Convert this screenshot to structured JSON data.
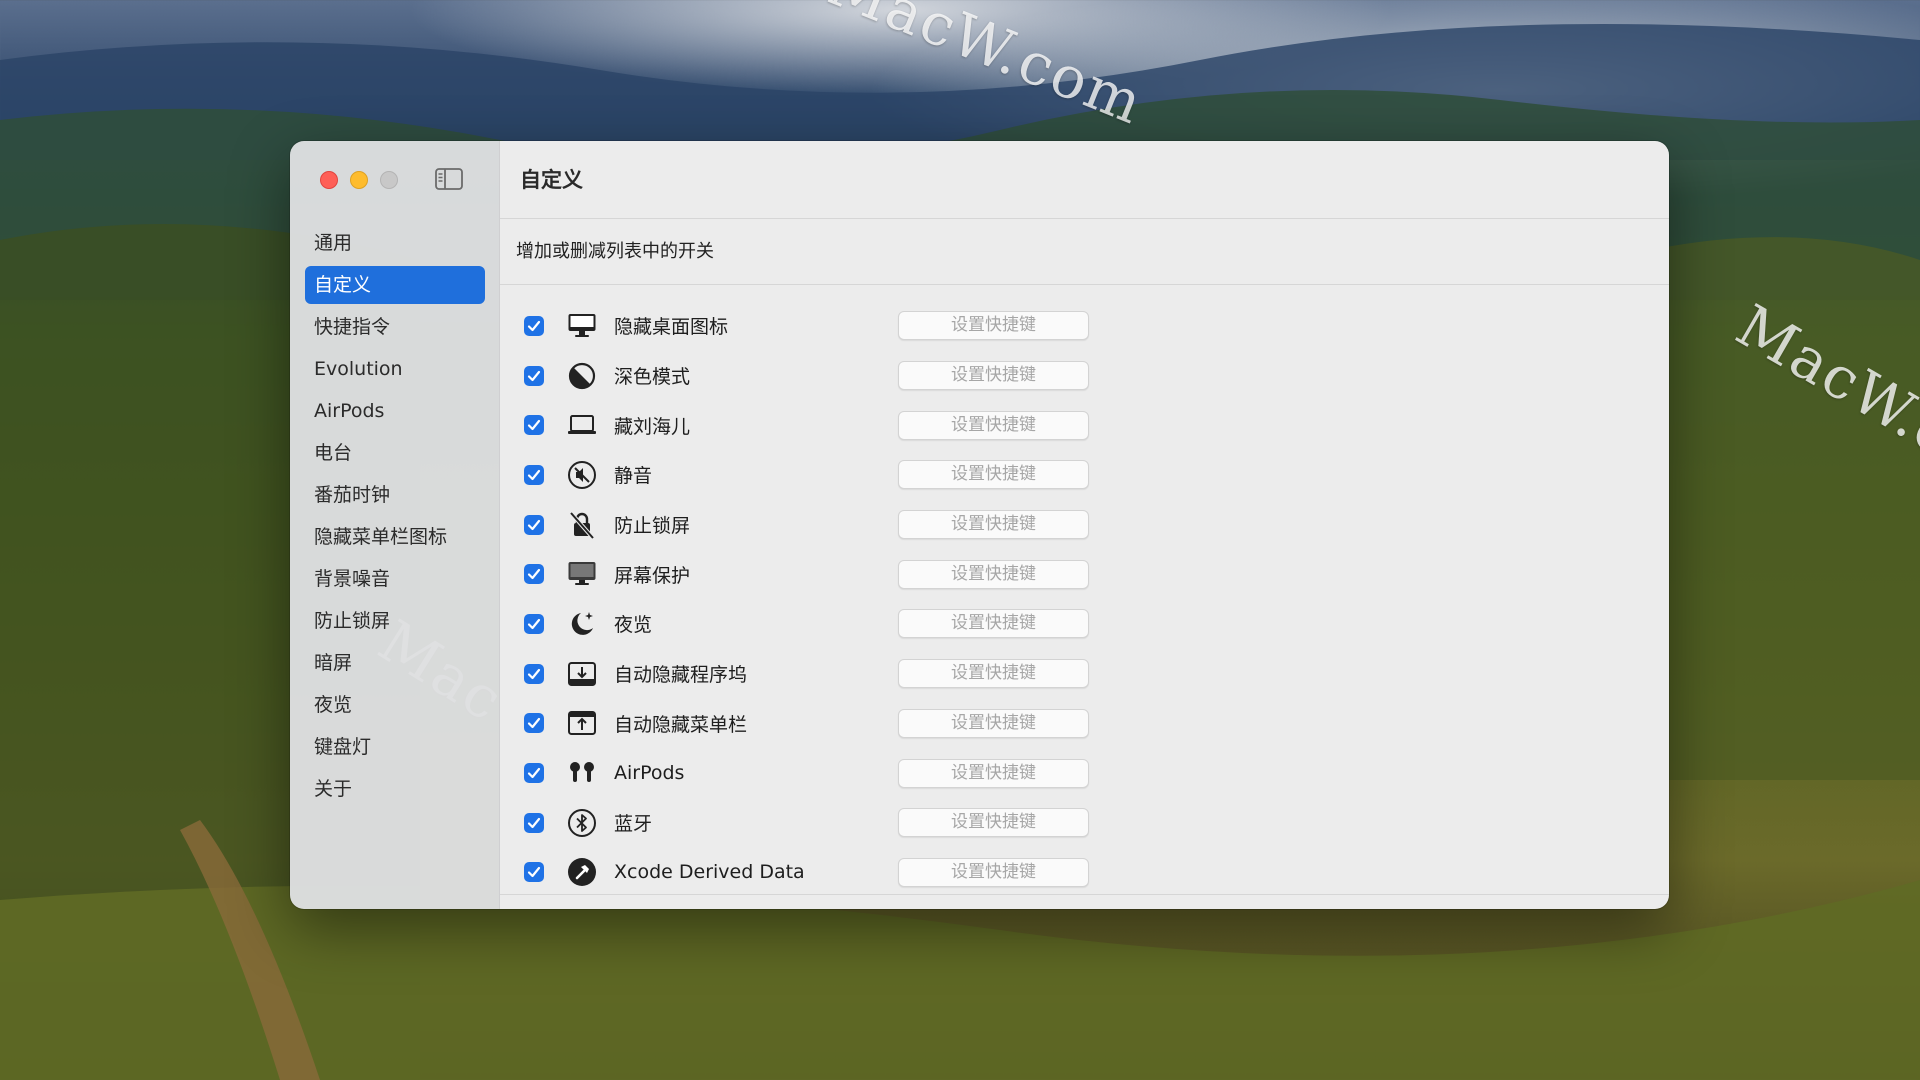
{
  "window": {
    "title": "自定义",
    "subtitle": "增加或删减列表中的开关"
  },
  "sidebar": {
    "items": [
      {
        "label": "通用",
        "active": false
      },
      {
        "label": "自定义",
        "active": true
      },
      {
        "label": "快捷指令",
        "active": false
      },
      {
        "label": "Evolution",
        "active": false
      },
      {
        "label": "AirPods",
        "active": false
      },
      {
        "label": "电台",
        "active": false
      },
      {
        "label": "番茄时钟",
        "active": false
      },
      {
        "label": "隐藏菜单栏图标",
        "active": false
      },
      {
        "label": "背景噪音",
        "active": false
      },
      {
        "label": "防止锁屏",
        "active": false
      },
      {
        "label": "暗屏",
        "active": false
      },
      {
        "label": "夜览",
        "active": false
      },
      {
        "label": "键盘灯",
        "active": false
      },
      {
        "label": "关于",
        "active": false
      }
    ]
  },
  "toggles": [
    {
      "label": "隐藏桌面图标",
      "icon": "desktop-icon",
      "checked": true,
      "shortcut": "设置快捷键"
    },
    {
      "label": "深色模式",
      "icon": "dark-mode-icon",
      "checked": true,
      "shortcut": "设置快捷键"
    },
    {
      "label": "藏刘海儿",
      "icon": "laptop-notch-icon",
      "checked": true,
      "shortcut": "设置快捷键"
    },
    {
      "label": "静音",
      "icon": "mute-icon",
      "checked": true,
      "shortcut": "设置快捷键"
    },
    {
      "label": "防止锁屏",
      "icon": "no-lock-icon",
      "checked": true,
      "shortcut": "设置快捷键"
    },
    {
      "label": "屏幕保护",
      "icon": "screensaver-icon",
      "checked": true,
      "shortcut": "设置快捷键"
    },
    {
      "label": "夜览",
      "icon": "moon-stars-icon",
      "checked": true,
      "shortcut": "设置快捷键"
    },
    {
      "label": "自动隐藏程序坞",
      "icon": "dock-hide-icon",
      "checked": true,
      "shortcut": "设置快捷键"
    },
    {
      "label": "自动隐藏菜单栏",
      "icon": "menubar-hide-icon",
      "checked": true,
      "shortcut": "设置快捷键"
    },
    {
      "label": "AirPods",
      "icon": "airpods-icon",
      "checked": true,
      "shortcut": "设置快捷键"
    },
    {
      "label": "蓝牙",
      "icon": "bluetooth-icon",
      "checked": true,
      "shortcut": "设置快捷键"
    },
    {
      "label": "Xcode Derived Data",
      "icon": "xcode-hammer-icon",
      "checked": true,
      "shortcut": "设置快捷键"
    }
  ],
  "watermark": "MacW.com",
  "colors": {
    "accent": "#1f6fdc",
    "checkbox": "#1f72e6",
    "close": "#fe5f57",
    "minimize": "#febc2e",
    "inactive": "#c8c8c8"
  }
}
